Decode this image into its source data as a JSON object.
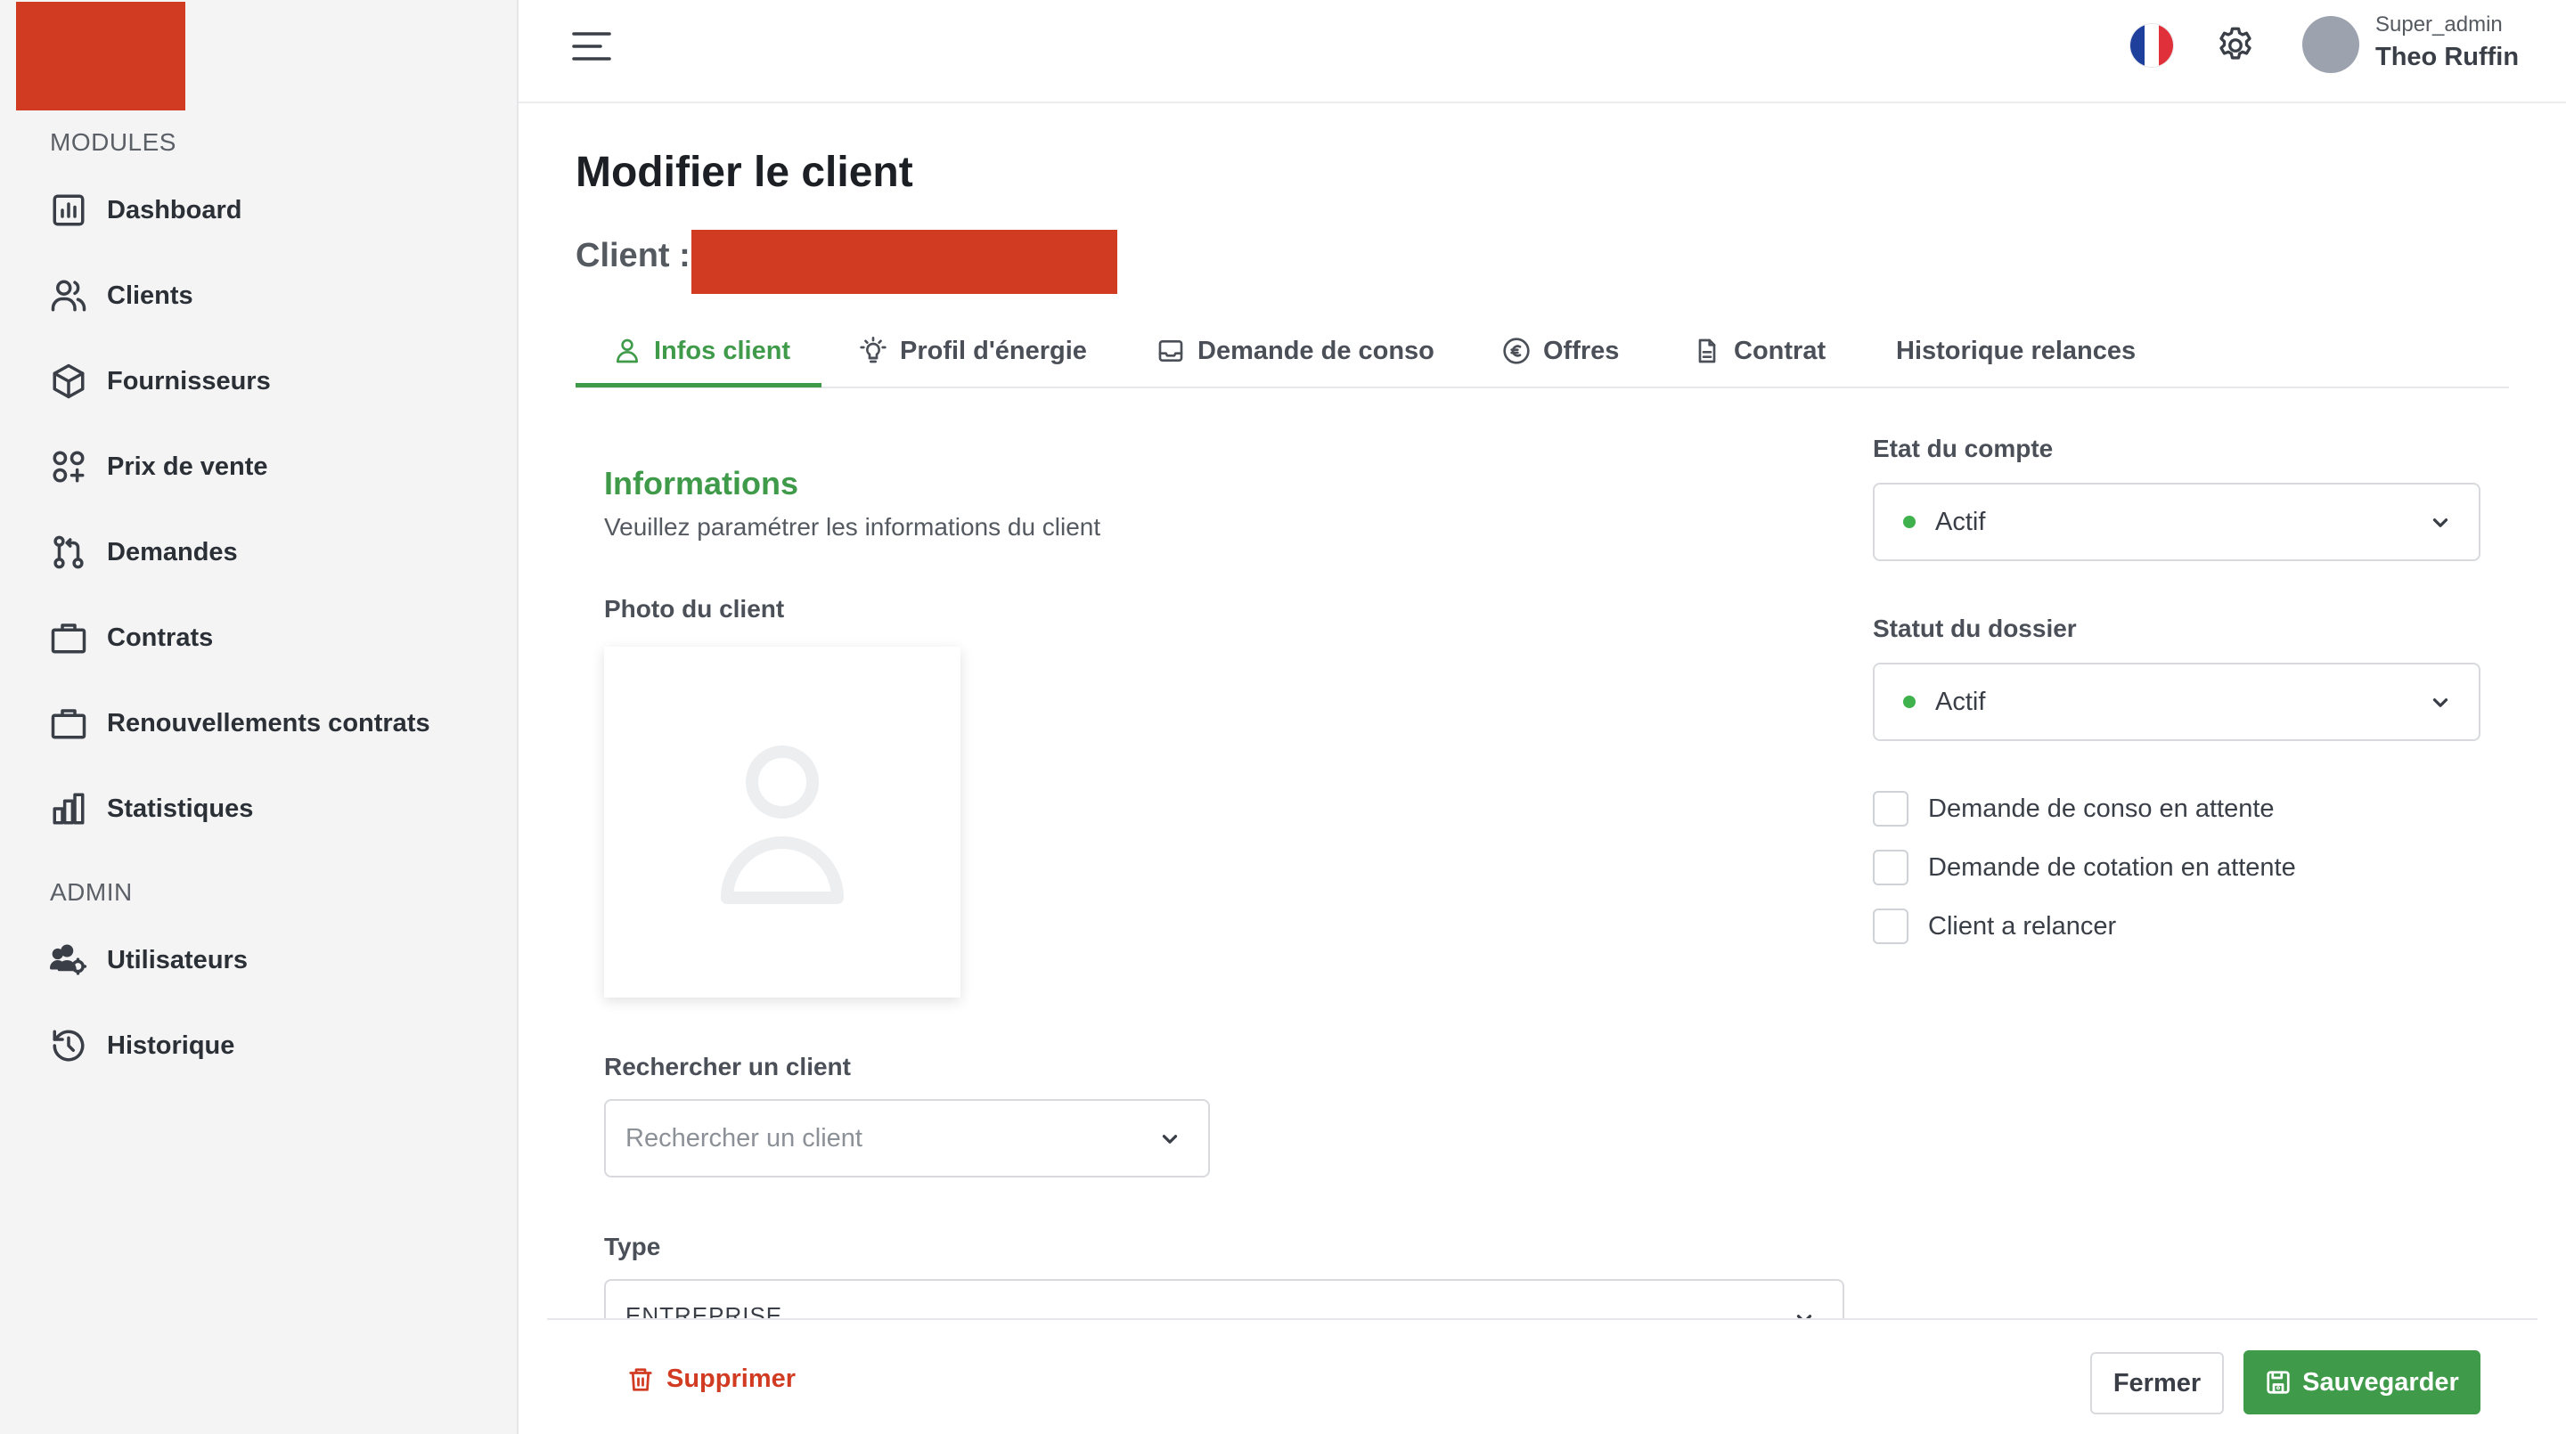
{
  "colors": {
    "accent": "#3f9a4a",
    "danger": "#d13b22",
    "status_dot": "#3fb24d"
  },
  "sidebar": {
    "sections": [
      {
        "label": "MODULES"
      },
      {
        "label": "ADMIN"
      }
    ],
    "items": [
      {
        "label": "Dashboard",
        "icon": "dashboard-icon"
      },
      {
        "label": "Clients",
        "icon": "users-icon"
      },
      {
        "label": "Fournisseurs",
        "icon": "box-icon"
      },
      {
        "label": "Prix de vente",
        "icon": "grid-plus-icon"
      },
      {
        "label": "Demandes",
        "icon": "git-pull-icon"
      },
      {
        "label": "Contrats",
        "icon": "briefcase-icon"
      },
      {
        "label": "Renouvellements contrats",
        "icon": "briefcase-icon"
      },
      {
        "label": "Statistiques",
        "icon": "bar-chart-icon"
      },
      {
        "label": "Utilisateurs",
        "icon": "users-cog-icon"
      },
      {
        "label": "Historique",
        "icon": "history-icon"
      }
    ]
  },
  "header": {
    "user_role": "Super_admin",
    "user_name": "Theo Ruffin",
    "language_flag": "france-flag-icon"
  },
  "main": {
    "title": "Modifier le client",
    "client_label": "Client :",
    "tabs": [
      {
        "label": "Infos client",
        "icon": "user-icon",
        "active": true
      },
      {
        "label": "Profil d'énergie",
        "icon": "lightbulb-icon"
      },
      {
        "label": "Demande de conso",
        "icon": "inbox-icon"
      },
      {
        "label": "Offres",
        "icon": "euro-icon"
      },
      {
        "label": "Contrat",
        "icon": "document-icon"
      },
      {
        "label": "Historique relances",
        "icon": ""
      }
    ],
    "info_title": "Informations",
    "info_subtitle": "Veuillez paramétrer les informations du client",
    "photo_label": "Photo du client",
    "search_label": "Rechercher un client",
    "search_placeholder": "Rechercher un client",
    "type_label": "Type",
    "type_value": "ENTREPRISE",
    "account_state_label": "Etat du compte",
    "account_state_value": "Actif",
    "file_status_label": "Statut du dossier",
    "file_status_value": "Actif",
    "checkboxes": [
      {
        "label": "Demande de conso en attente",
        "checked": false
      },
      {
        "label": "Demande de cotation en attente",
        "checked": false
      },
      {
        "label": "Client a relancer",
        "checked": false
      }
    ]
  },
  "footer": {
    "delete_label": "Supprimer",
    "close_label": "Fermer",
    "save_label": "Sauvegarder"
  }
}
